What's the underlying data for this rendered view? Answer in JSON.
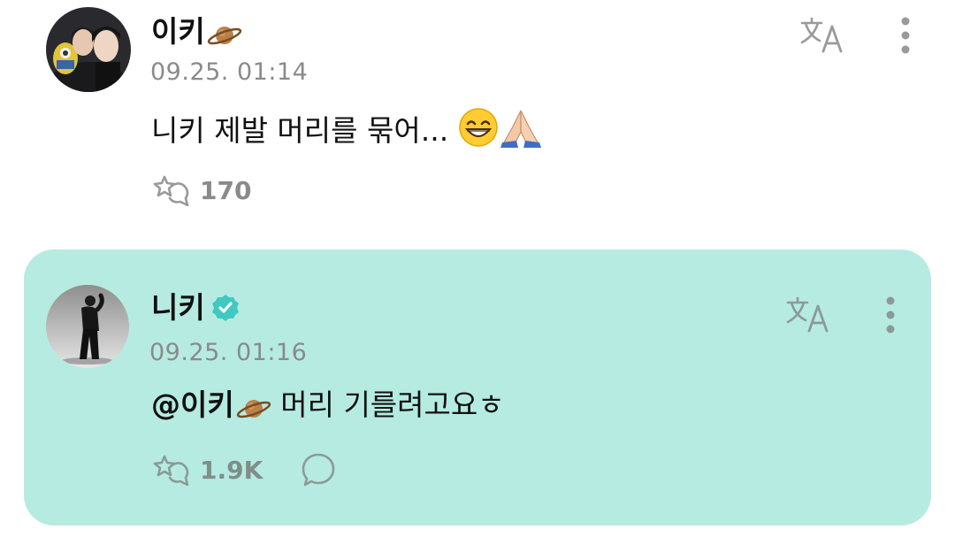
{
  "post": {
    "username": "이키",
    "username_emoji": "ringed-planet",
    "timestamp": "09.25. 01:14",
    "text": "니키 제발 머리를 묶어...",
    "text_emojis": [
      "beaming-face-with-smiling-eyes",
      "folded-hands"
    ],
    "like_icon": "star-hand-like-icon",
    "like_count": "170",
    "translate_icon": "translate-icon",
    "more_icon": "kebab-menu-icon"
  },
  "reply": {
    "username": "니키",
    "verified_icon": "verified-badge-icon",
    "timestamp": "09.25. 01:16",
    "mention": "@이키",
    "mention_emoji": "ringed-planet",
    "text": "머리 기를려고요ㅎ",
    "like_icon": "star-hand-like-icon",
    "like_count": "1.9K",
    "reply_icon": "speech-bubble-icon",
    "translate_icon": "translate-icon",
    "more_icon": "kebab-menu-icon",
    "background_color": "#b6ebe2",
    "verified_color": "#3fc9c0"
  },
  "colors": {
    "text_primary": "#111111",
    "text_secondary": "#8a8a8a",
    "icon_gray": "#9a9a9a"
  }
}
